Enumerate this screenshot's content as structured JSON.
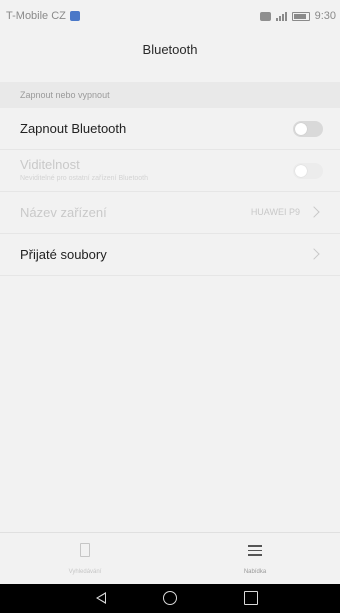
{
  "status_bar": {
    "carrier": "T-Mobile CZ",
    "time": "9:30",
    "icons": [
      "sim-icon",
      "photo-icon",
      "signal-icon",
      "battery-icon"
    ]
  },
  "header": {
    "title": "Bluetooth"
  },
  "section": {
    "header": "Zapnout nebo vypnout"
  },
  "rows": {
    "bluetooth": {
      "label": "Zapnout Bluetooth",
      "toggle_on": false
    },
    "visibility": {
      "label": "Viditelnost",
      "sublabel": "Neviditelné pro ostatní zařízení Bluetooth",
      "toggle_on": false,
      "enabled": false
    },
    "device_name": {
      "label": "Název zařízení",
      "value": "HUAWEI P9",
      "enabled": false
    },
    "received_files": {
      "label": "Přijaté soubory"
    }
  },
  "bottom_bar": {
    "scan_label": "Vyhledávání",
    "menu_label": "Nabídka"
  },
  "colors": {
    "background": "#f2f2f2",
    "section_header_bg": "#e9e9e9",
    "toggle_off": "#d9d9d9",
    "navbar": "#000000"
  }
}
